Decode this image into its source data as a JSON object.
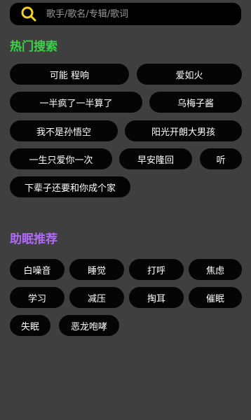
{
  "search": {
    "placeholder": "歌手/歌名/专辑/歌词"
  },
  "colors": {
    "hot_title": "#3ed14b",
    "sleep_title": "#b16af5",
    "accent_icon": "#f4d024"
  },
  "hot_search": {
    "title": "热门搜索",
    "items": [
      "可能  程响",
      "爱如火",
      "一半疯了一半算了",
      "乌梅子酱",
      "我不是孙悟空",
      "阳光开朗大男孩",
      "一生只爱你一次",
      "早安隆回",
      "听",
      "下辈子还要和你成个家"
    ]
  },
  "sleep": {
    "title": "助眠推荐",
    "items": [
      "白噪音",
      "睡觉",
      "打呼",
      "焦虑",
      "学习",
      "减压",
      "掏耳",
      "催眠",
      "失眠",
      "恶龙咆哮"
    ]
  }
}
